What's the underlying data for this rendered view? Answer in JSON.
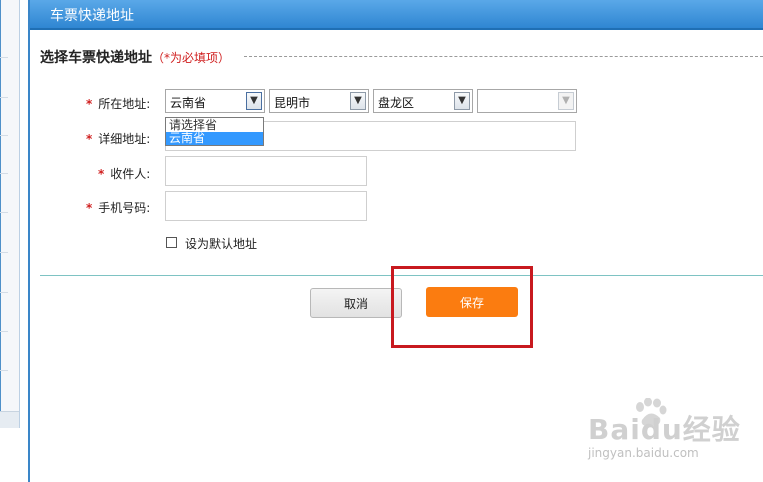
{
  "header": {
    "title": "车票快递地址"
  },
  "section": {
    "title": "选择车票快递地址",
    "note": "（*为必填项）"
  },
  "form": {
    "required_mark": "*",
    "address": {
      "label": "所在地址:",
      "province": "云南省",
      "city": "昆明市",
      "district": "盘龙区",
      "extra": "",
      "province_options": [
        "请选择省",
        "云南省"
      ],
      "highlighted_option_index": 1
    },
    "detail": {
      "label": "详细地址:",
      "value": ""
    },
    "recipient": {
      "label": "收件人:",
      "value": ""
    },
    "phone": {
      "label": "手机号码:",
      "value": ""
    },
    "default_checkbox": {
      "label": "设为默认地址",
      "checked": false
    }
  },
  "buttons": {
    "cancel": "取消",
    "save": "保存"
  },
  "watermark": {
    "brand": "Baidu经验",
    "url": "jingyan.baidu.com"
  },
  "colors": {
    "header_blue": "#3a8fd8",
    "save_orange": "#fb7c10",
    "required_red": "#d01f1f",
    "highlight_red": "#c8191f"
  }
}
